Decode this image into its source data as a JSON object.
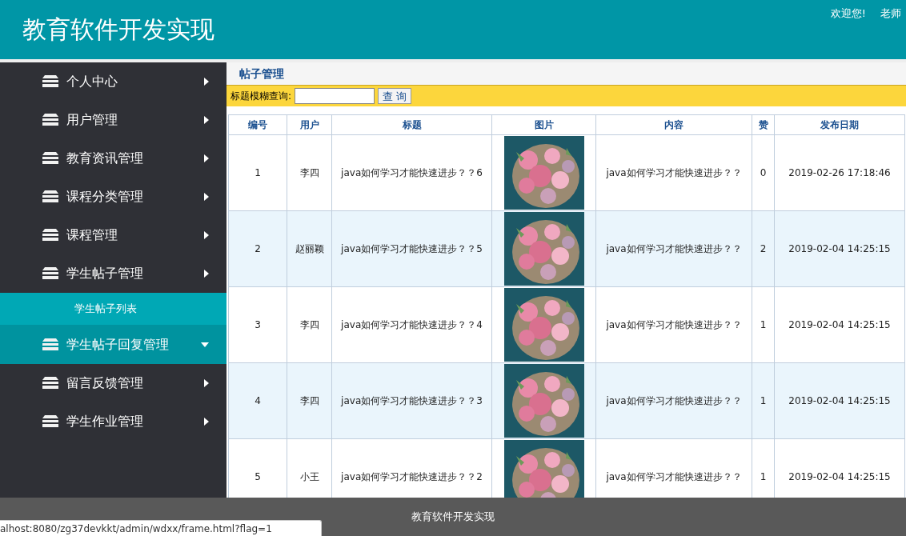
{
  "header": {
    "title": "教育软件开发实现",
    "welcome": "欢迎您!",
    "user": "老师"
  },
  "sidebar": {
    "items": [
      {
        "kind": "menu",
        "label": "个人中心",
        "expanded": false
      },
      {
        "kind": "menu",
        "label": "用户管理",
        "expanded": false
      },
      {
        "kind": "menu",
        "label": "教育资讯管理",
        "expanded": false
      },
      {
        "kind": "menu",
        "label": "课程分类管理",
        "expanded": false
      },
      {
        "kind": "menu",
        "label": "课程管理",
        "expanded": false
      },
      {
        "kind": "menu",
        "label": "学生帖子管理",
        "expanded": false
      },
      {
        "kind": "sub",
        "label": "学生帖子列表"
      },
      {
        "kind": "menu",
        "label": "学生帖子回复管理",
        "expanded": true
      },
      {
        "kind": "menu",
        "label": "留言反馈管理",
        "expanded": false
      },
      {
        "kind": "menu",
        "label": "学生作业管理",
        "expanded": false
      }
    ]
  },
  "panel": {
    "title": "帖子管理",
    "search_label": "标题模糊查询:",
    "search_button": "查 询"
  },
  "table": {
    "columns": [
      "编号",
      "用户",
      "标题",
      "图片",
      "内容",
      "赞",
      "发布日期"
    ],
    "rows": [
      {
        "id": "1",
        "user": "李四",
        "title": "java如何学习才能快速进步？？6",
        "content": "java如何学习才能快速进步？？",
        "likes": "0",
        "date": "2019-02-26 17:18:46"
      },
      {
        "id": "2",
        "user": "赵丽颖",
        "title": "java如何学习才能快速进步？？5",
        "content": "java如何学习才能快速进步？？",
        "likes": "2",
        "date": "2019-02-04 14:25:15"
      },
      {
        "id": "3",
        "user": "李四",
        "title": "java如何学习才能快速进步？？4",
        "content": "java如何学习才能快速进步？？",
        "likes": "1",
        "date": "2019-02-04 14:25:15"
      },
      {
        "id": "4",
        "user": "李四",
        "title": "java如何学习才能快速进步？？3",
        "content": "java如何学习才能快速进步？？",
        "likes": "1",
        "date": "2019-02-04 14:25:15"
      },
      {
        "id": "5",
        "user": "小王",
        "title": "java如何学习才能快速进步？？2",
        "content": "java如何学习才能快速进步？？",
        "likes": "1",
        "date": "2019-02-04 14:25:15"
      }
    ]
  },
  "footer": {
    "text": "教育软件开发实现"
  },
  "status_url": "alhost:8080/zg37devkkt/admin/wdxx/frame.html?flag=1"
}
